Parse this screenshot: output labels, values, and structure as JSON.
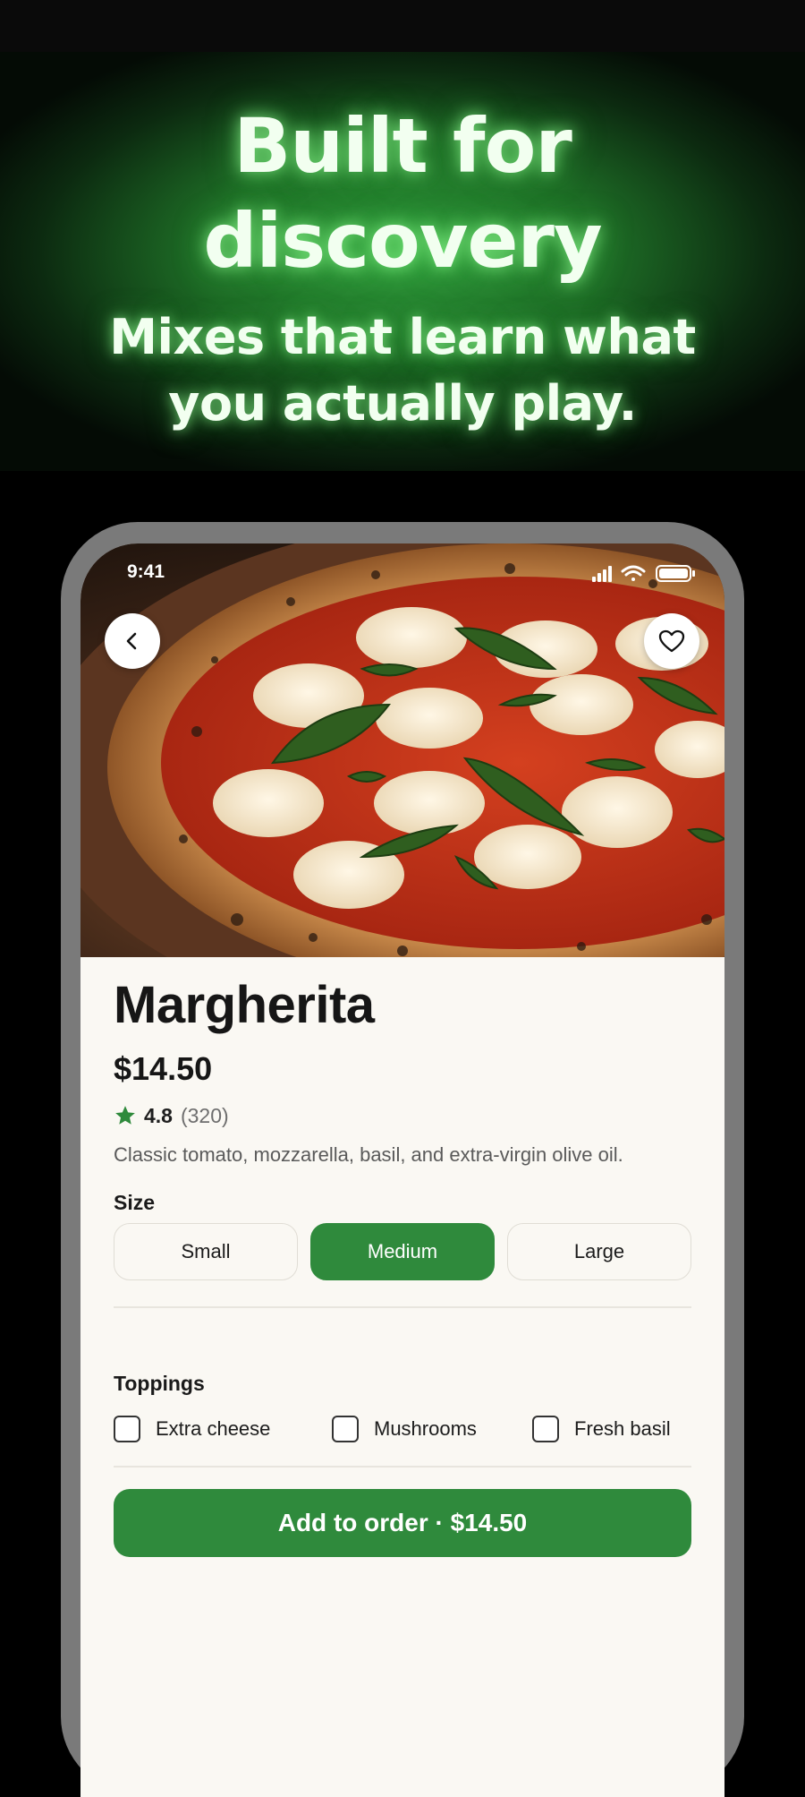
{
  "promo": {
    "headline": "Built for discovery",
    "subheadline": "Mixes that learn what you actually play."
  },
  "status_bar": {
    "time": "9:41"
  },
  "nav": {
    "back_icon": "chevron-left-icon",
    "favorite_icon": "heart-icon"
  },
  "item": {
    "name": "Margherita",
    "price": "$14.50",
    "rating": "4.8",
    "review_count": "(320)",
    "description": "Classic tomato, mozzarella, basil, and extra-virgin olive oil."
  },
  "size": {
    "label": "Size",
    "options": [
      "Small",
      "Medium",
      "Large"
    ],
    "selected": "Medium"
  },
  "toppings": {
    "label": "Toppings",
    "options": [
      "Extra cheese",
      "Mushrooms",
      "Fresh basil"
    ]
  },
  "cta": {
    "label": "Add to order · $14.50"
  },
  "colors": {
    "accent_green": "#2f8a3c",
    "background": "#faf8f3",
    "hero_glow": "#2f9c3b"
  }
}
